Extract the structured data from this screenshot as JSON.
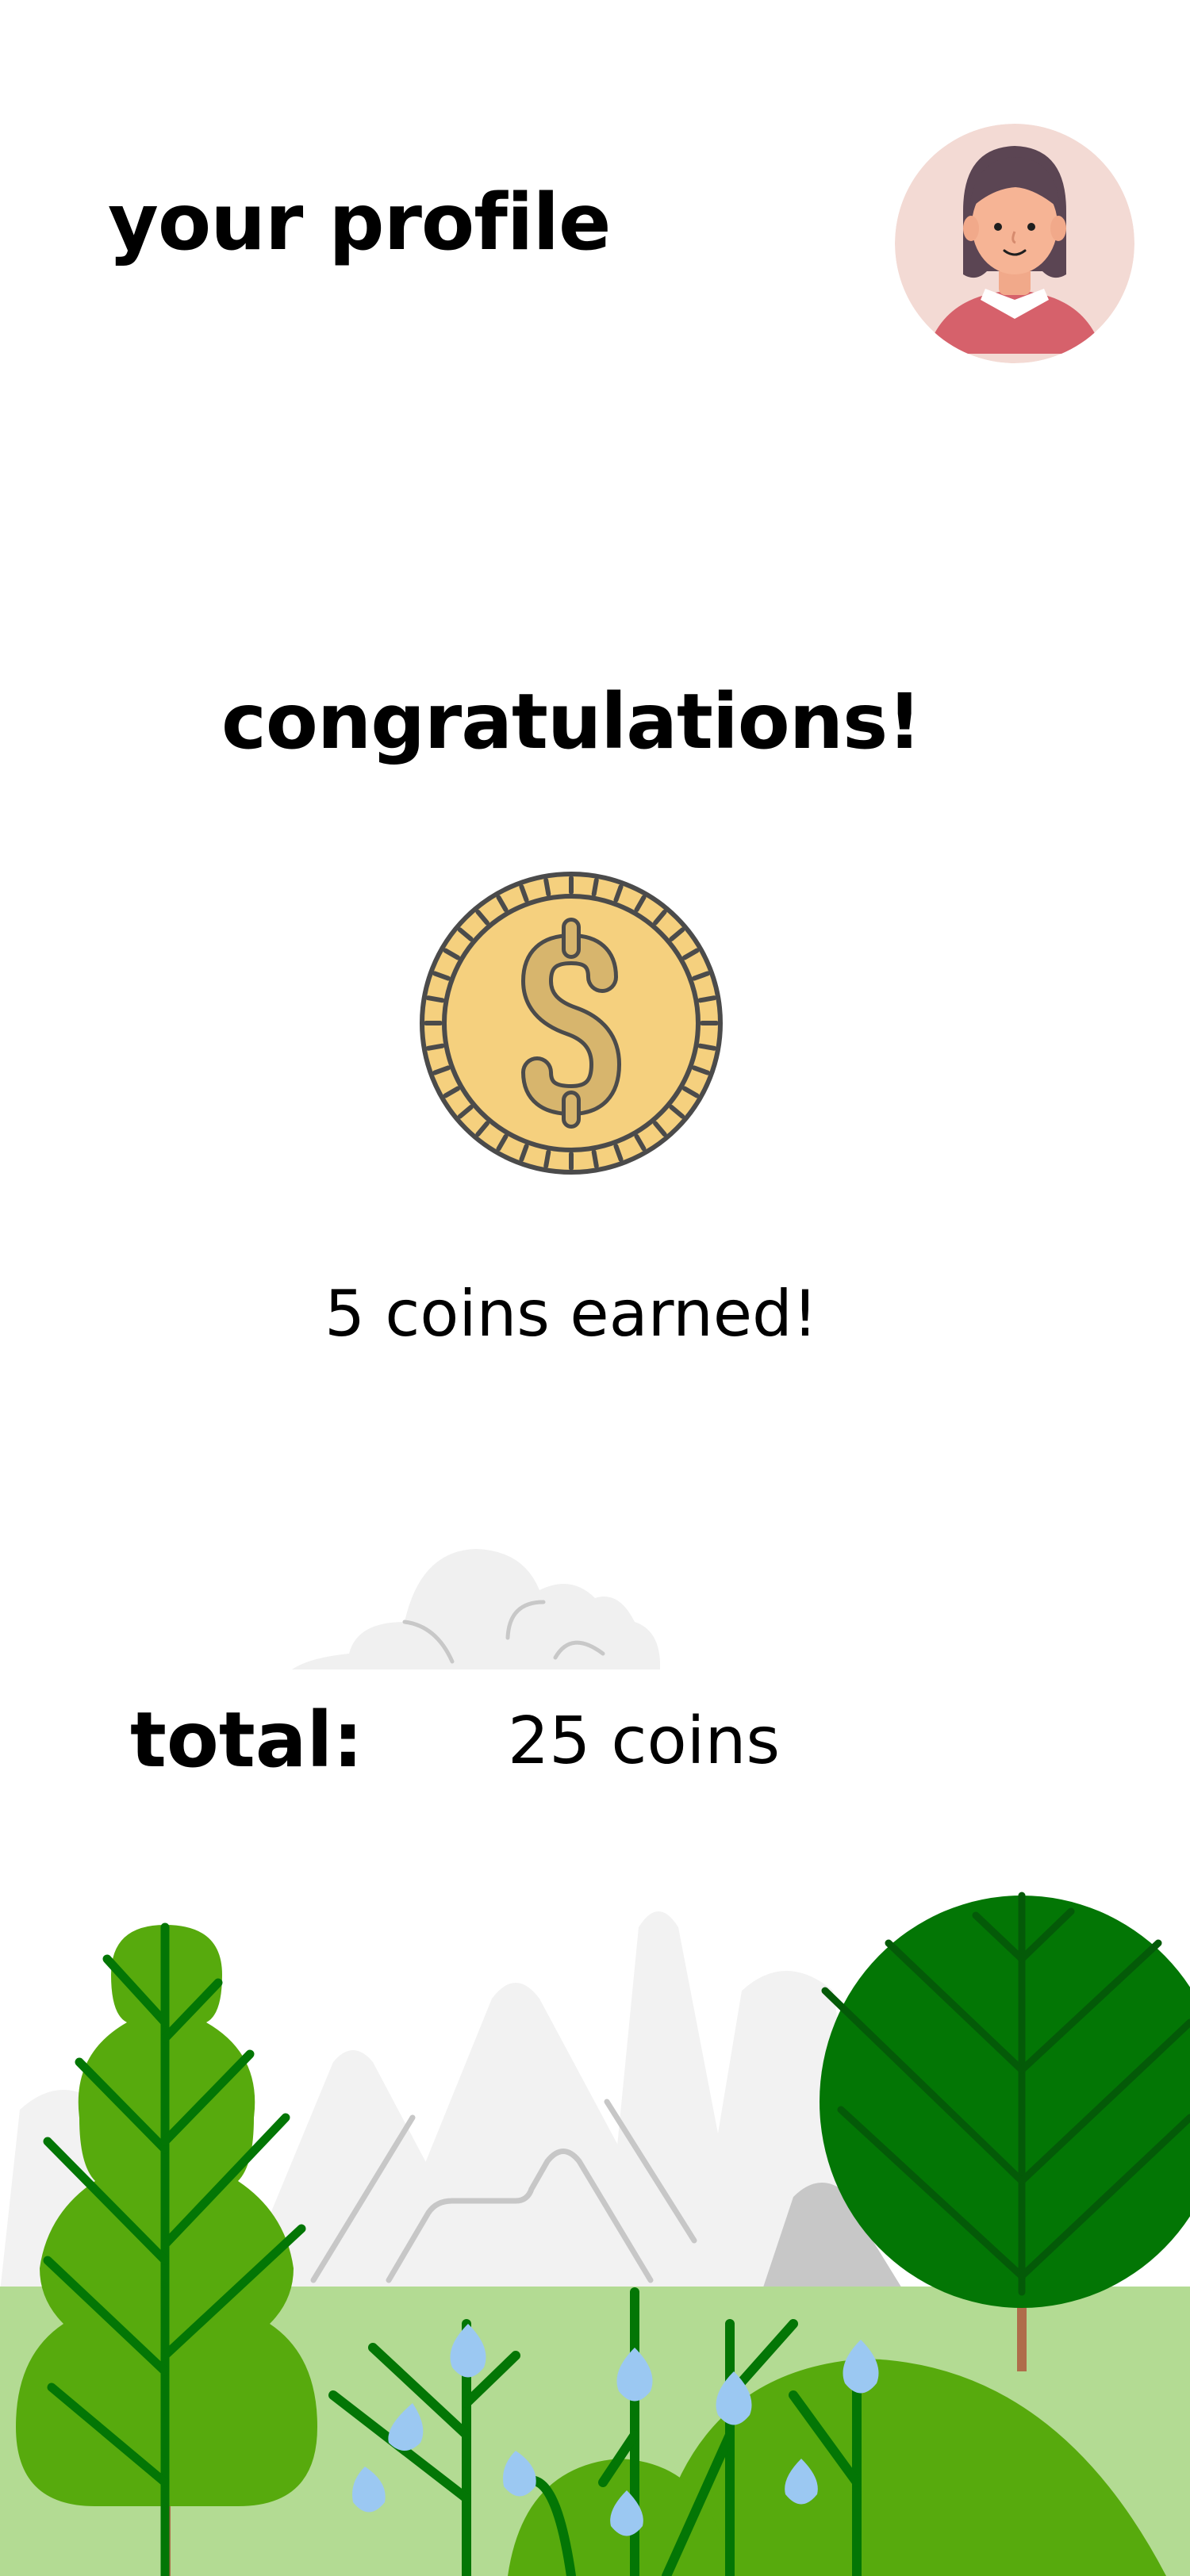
{
  "header": {
    "title": "your profile"
  },
  "avatar": {
    "icon": "user-avatar-icon"
  },
  "reward": {
    "heading": "congratulations!",
    "coin_icon": "dollar-coin-icon",
    "earned_text": "5 coins earned!"
  },
  "summary": {
    "total_label": "total:",
    "total_value": "25 coins"
  },
  "colors": {
    "coin_gold": "#F5D07E",
    "coin_outline": "#4B4B4B",
    "grass": "#B3DB93",
    "tree_light": "#57AA0D",
    "tree_dark": "#037605",
    "mountain": "#F2F2F2",
    "bud": "#9BC8F2"
  }
}
